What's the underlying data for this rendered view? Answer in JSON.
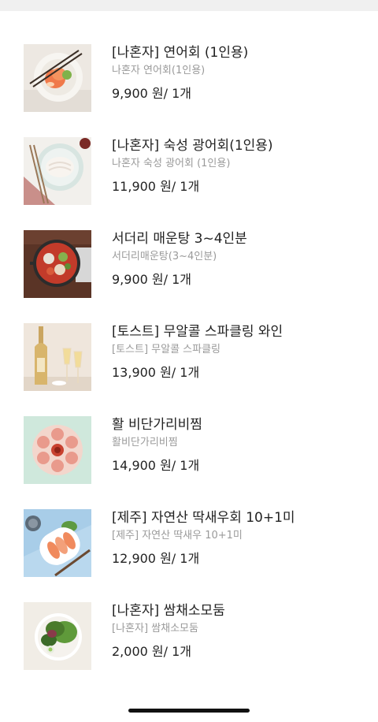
{
  "items": [
    {
      "name": "[나혼자] 연어회 (1인용)",
      "subtitle": "나혼자 연어회(1인용)",
      "price": "9,900 원",
      "quantity": "/ 1개",
      "image": "salmon-sashimi-photo"
    },
    {
      "name": "[나혼자] 숙성 광어회(1인용)",
      "subtitle": "나혼자 숙성 광어회 (1인용)",
      "price": "11,900 원",
      "quantity": "/ 1개",
      "image": "flatfish-sashimi-photo"
    },
    {
      "name": "서더리 매운탕 3~4인분",
      "subtitle": "서더리매운탕(3~4인분)",
      "price": "9,900 원",
      "quantity": "/ 1개",
      "image": "spicy-fish-stew-photo"
    },
    {
      "name": "[토스트] 무알콜 스파클링 와인",
      "subtitle": "[토스트] 무알콜 스파클링",
      "price": "13,900 원",
      "quantity": "/ 1개",
      "image": "sparkling-wine-photo"
    },
    {
      "name": "활 비단가리비찜",
      "subtitle": "활비단가리비찜",
      "price": "14,900 원",
      "quantity": "/ 1개",
      "image": "steamed-scallop-photo"
    },
    {
      "name": "[제주] 자연산 딱새우회 10+1미",
      "subtitle": "[제주] 자연산 딱새우 10+1미",
      "price": "12,900 원",
      "quantity": "/ 1개",
      "image": "shrimp-sashimi-photo"
    },
    {
      "name": "[나혼자] 쌈채소모둠",
      "subtitle": "[나혼자] 쌈채소모둠",
      "price": "2,000 원",
      "quantity": "/ 1개",
      "image": "lettuce-wrap-photo"
    }
  ]
}
